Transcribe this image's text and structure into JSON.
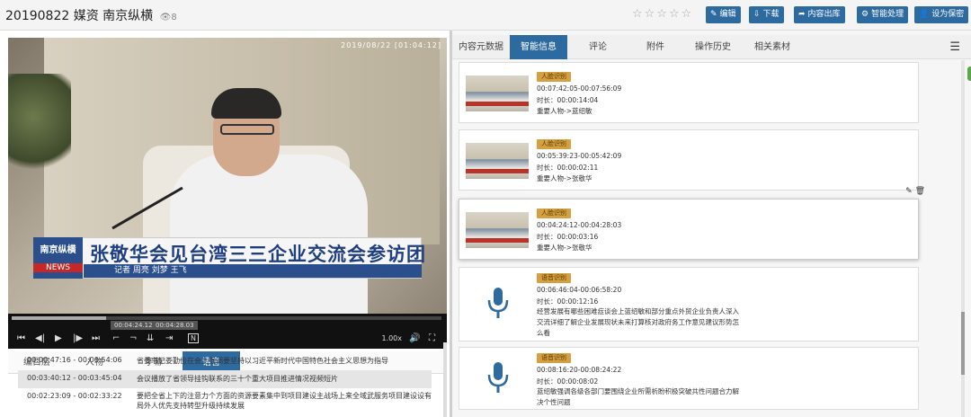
{
  "header": {
    "title": "20190822 媒资 南京纵横",
    "view_count": "8",
    "stars": "☆☆☆☆☆",
    "buttons": [
      {
        "icon": "✎",
        "label": "编辑"
      },
      {
        "icon": "⇩",
        "label": "下载"
      },
      {
        "icon": "➦",
        "label": "内容出库"
      },
      {
        "icon": "⚙",
        "label": "智能处理"
      },
      {
        "icon": "👤",
        "label": "设为保密"
      }
    ]
  },
  "video": {
    "stamp": "2019/08/22 [01:04:12]",
    "caption_logo": "南京纵横",
    "caption_news": "NEWS",
    "headline": "张敬华会见台湾三三企业交流会参访团",
    "byline": "记者 周亮 刘梦 王飞",
    "progress": 0.22,
    "current_time": "00:04:24.12",
    "end_time": "00:04:28.03",
    "speed": "1.00x",
    "n_label": "N"
  },
  "left_tabs": [
    {
      "label": "编目层",
      "active": false
    },
    {
      "label": "人物",
      "active": false
    },
    {
      "label": "字幕",
      "active": false
    },
    {
      "label": "语音",
      "active": true
    }
  ],
  "voice_rows": [
    {
      "time": "00:00:47:16 - 00:00:54:06",
      "text": "省委书记娄勤俭在会上强调要坚持以习近平新时代中国特色社会主义思想为指导"
    },
    {
      "time": "00:03:40:12 - 00:03:45:04",
      "text": "会议播放了省领导挂钩联系的三十个重大项目推进情况视频短片"
    },
    {
      "time": "00:02:23:09 - 00:02:33:22",
      "text": "要把全省上下的注意力个方面的资源要素集中到项目建设主战场上来全域武服务项目建设设有局外人优先支持转型升级持续发展"
    }
  ],
  "right_tabs": [
    {
      "label": "内容元数据",
      "active": false
    },
    {
      "label": "智能信息",
      "active": true
    },
    {
      "label": "评论",
      "active": false
    },
    {
      "label": "附件",
      "active": false
    },
    {
      "label": "操作历史",
      "active": false
    },
    {
      "label": "相关素材",
      "active": false
    }
  ],
  "cards": [
    {
      "kind": "face",
      "tag": "人脸识别",
      "range": "00:07:42:05-00:07:56:09",
      "duration": "时长：00:00:14:04",
      "detail": "重要人物->蓝绍敏"
    },
    {
      "kind": "face",
      "tag": "人脸识别",
      "range": "00:05:39:23-00:05:42:09",
      "duration": "时长：00:00:02:11",
      "detail": "重要人物->张敬华"
    },
    {
      "kind": "face",
      "tag": "人脸识别",
      "range": "00:04:24:12-00:04:28:03",
      "duration": "时长：00:00:03:16",
      "detail": "重要人物->张敬华"
    },
    {
      "kind": "voice",
      "tag": "语音识别",
      "range": "00:06:46:04-00:06:58:20",
      "duration": "时长：00:00:12:16",
      "detail": "经营发展有哪些困难症谈会上蓝绍敏和部分重点外贸企业负责人深入交流详细了解企业发展现状未来打算核对政府务工作意见建议形势怎么看"
    },
    {
      "kind": "voice",
      "tag": "语音识别",
      "range": "00:08:16:20-00:08:24:22",
      "duration": "时长：00:00:08:02",
      "detail": "蓝绍敏强调各级各部门要围绕企业所需析盼积极突破共性问题合力解决个性问题"
    }
  ],
  "menu_icon": "☰",
  "card_tools": "✎ 🗑",
  "colors": {
    "accent": "#2d6a9f",
    "tag": "#d4a041",
    "mic": "#2d6a9f"
  }
}
